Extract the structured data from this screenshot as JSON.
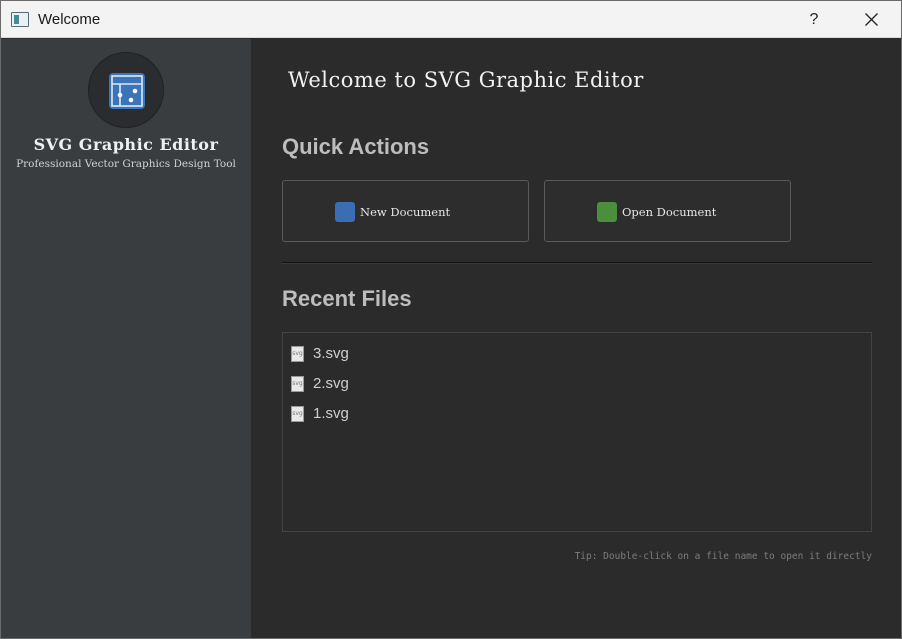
{
  "window": {
    "title": "Welcome",
    "help_label": "?"
  },
  "sidebar": {
    "app_name": "SVG Graphic Editor",
    "tagline": "Professional Vector Graphics Design Tool"
  },
  "main": {
    "welcome_title": "Welcome to SVG Graphic Editor",
    "quick_actions": {
      "title": "Quick Actions",
      "new_label": "New Document",
      "open_label": "Open Document",
      "new_color": "#3b6db3",
      "open_color": "#4a8f3c"
    },
    "recent_files": {
      "title": "Recent Files",
      "items": [
        {
          "name": "3.svg",
          "icon": "svg-file-icon",
          "icon_text": "svg"
        },
        {
          "name": "2.svg",
          "icon": "svg-file-icon",
          "icon_text": "svg"
        },
        {
          "name": "1.svg",
          "icon": "svg-file-icon",
          "icon_text": "svg"
        }
      ]
    },
    "tip": "Tip: Double-click on a file name to open it directly"
  },
  "colors": {
    "sidebar_bg": "#3a3d40",
    "main_bg": "#2b2b2b",
    "logo_accent": "#3a75b8"
  }
}
